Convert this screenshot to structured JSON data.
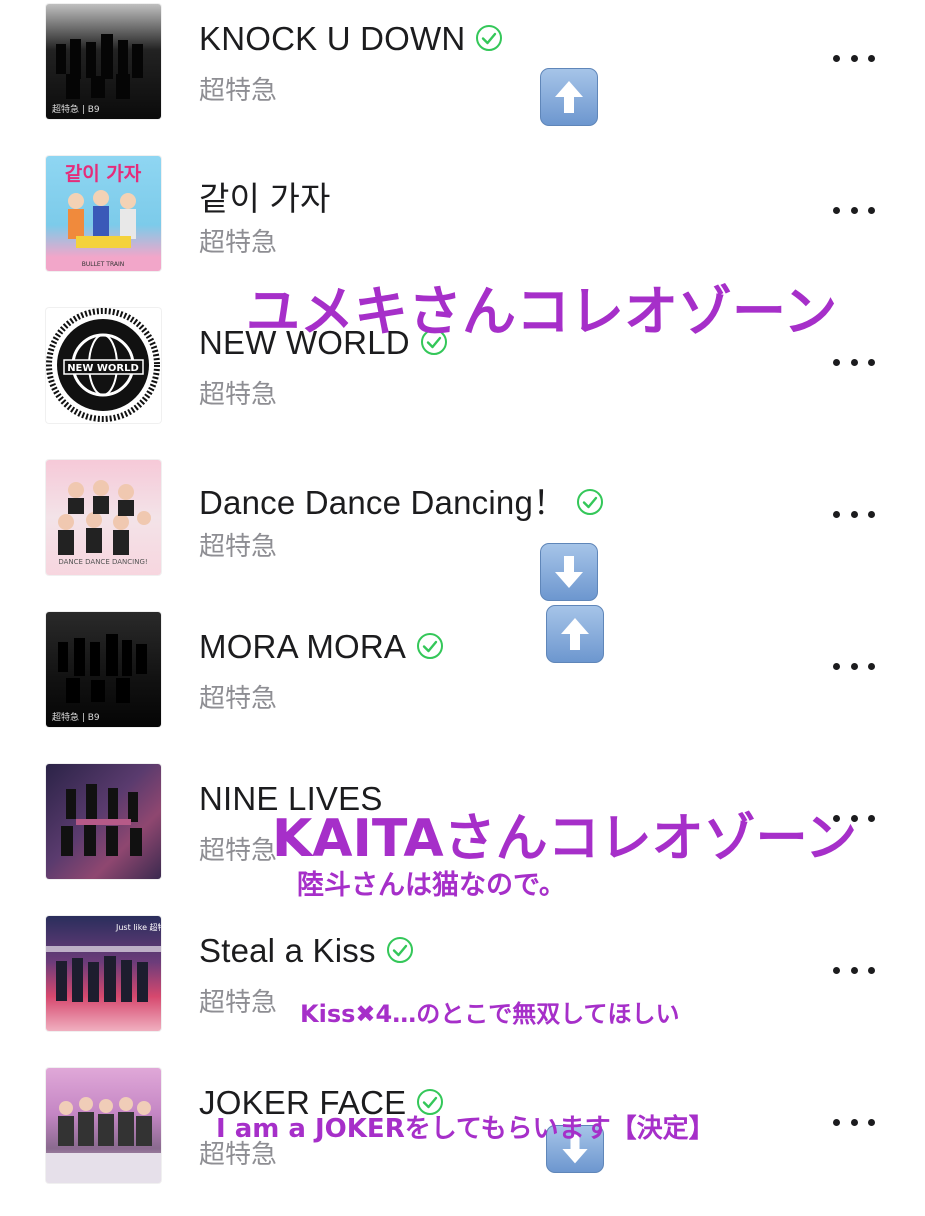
{
  "songs": [
    {
      "title": "KNOCK U DOWN",
      "artist": "超特急",
      "downloaded": true,
      "art_text": "超特急 | B9"
    },
    {
      "title": "같이 가자",
      "artist": "超特急",
      "downloaded": false,
      "art_text": "같이 가자",
      "art_sub": "BULLET TRAIN"
    },
    {
      "title": "NEW WORLD",
      "artist": "超特急",
      "downloaded": true,
      "art_text": "NEW WORLD"
    },
    {
      "title": "Dance Dance Dancing！",
      "artist": "超特急",
      "downloaded": true,
      "art_text": "DANCE DANCE DANCING!"
    },
    {
      "title": "MORA MORA",
      "artist": "超特急",
      "downloaded": true,
      "art_text": "超特急 | B9"
    },
    {
      "title": "NINE LIVES",
      "artist": "超特急",
      "downloaded": false,
      "art_text": ""
    },
    {
      "title": "Steal a Kiss",
      "artist": "超特急",
      "downloaded": true,
      "art_text": "Just like 超特急"
    },
    {
      "title": "JOKER FACE",
      "artist": "超特急",
      "downloaded": true,
      "art_text": ""
    }
  ],
  "annotations": {
    "yumeki_zone": "ユメキさんコレオゾーン",
    "kaita_zone": "KAITAさんコレオゾーン",
    "cat_note": "陸斗さんは猫なので。",
    "kiss_note": "Kiss✖︎4…のとこで無双してほしい",
    "joker_note": "I am a JOKERをしてもらいます【決定】"
  },
  "colors": {
    "annotation": "#a62fc9",
    "check": "#34c759",
    "arrow_button": "#7ba3d6"
  },
  "icons": {
    "check": "circle-check-icon",
    "more": "more-dots-icon",
    "up": "up-arrow-emoji-icon",
    "down": "down-arrow-emoji-icon"
  }
}
